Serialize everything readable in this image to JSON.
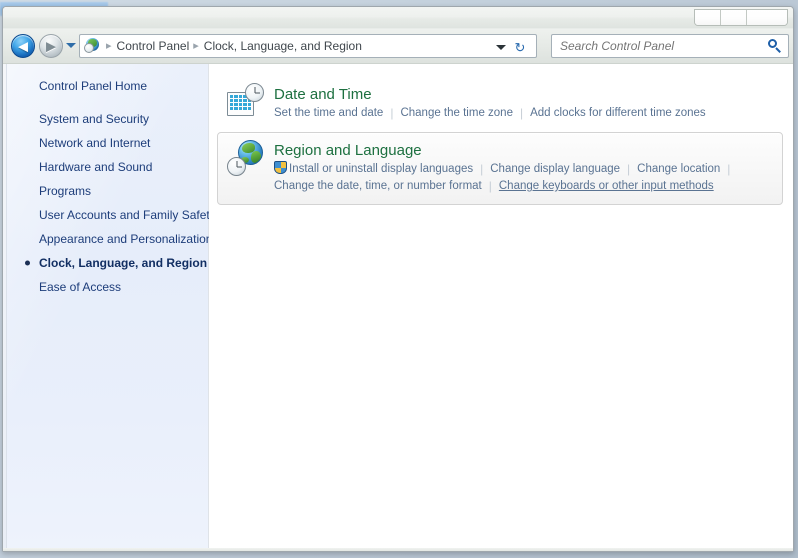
{
  "window": {
    "title": "",
    "buttons": [
      {
        "name": "minimize",
        "label": ""
      },
      {
        "name": "maximize",
        "label": ""
      },
      {
        "name": "close",
        "label": ""
      }
    ]
  },
  "toolbar": {
    "back_label": "◀",
    "forward_label": "▶",
    "recent_pages_label": "",
    "refresh_label": "↻",
    "breadcrumb_icon": "control-panel-globe-icon",
    "breadcrumbs": [
      "Control Panel",
      "Clock, Language, and Region"
    ],
    "separator": "▸"
  },
  "search": {
    "placeholder": "Search Control Panel",
    "value": "",
    "icon": "search-icon"
  },
  "sidebar": {
    "home": {
      "label": "Control Panel Home"
    },
    "items": [
      {
        "label": "System and Security",
        "selected": false
      },
      {
        "label": "Network and Internet",
        "selected": false
      },
      {
        "label": "Hardware and Sound",
        "selected": false
      },
      {
        "label": "Programs",
        "selected": false
      },
      {
        "label": "User Accounts and Family Safety",
        "selected": false
      },
      {
        "label": "Appearance and Personalization",
        "selected": false
      },
      {
        "label": "Clock, Language, and Region",
        "selected": true
      },
      {
        "label": "Ease of Access",
        "selected": false
      }
    ]
  },
  "main": {
    "categories": [
      {
        "id": "date-and-time",
        "icon": "calendar-clock-icon",
        "title": "Date and Time",
        "hover": false,
        "links": [
          {
            "label": "Set the time and date",
            "shield": false,
            "underlined": false
          },
          {
            "label": "Change the time zone",
            "shield": false,
            "underlined": false
          },
          {
            "label": "Add clocks for different time zones",
            "shield": false,
            "underlined": false
          }
        ],
        "row_break_after": -1
      },
      {
        "id": "region-and-language",
        "icon": "globe-clock-icon",
        "title": "Region and Language",
        "hover": true,
        "links": [
          {
            "label": "Install or uninstall display languages",
            "shield": true,
            "underlined": false
          },
          {
            "label": "Change display language",
            "shield": false,
            "underlined": false
          },
          {
            "label": "Change location",
            "shield": false,
            "underlined": false
          },
          {
            "label": "Change the date, time, or number format",
            "shield": false,
            "underlined": false
          },
          {
            "label": "Change keyboards or other input methods",
            "shield": false,
            "underlined": true
          }
        ],
        "row_break_after": 2
      }
    ]
  },
  "colors": {
    "category_title": "#1d7040",
    "link": "#5a7392",
    "sidebar_text": "#1d3d7a",
    "sidebar_bg": "#e8eefb",
    "accent_blue": "#1e5fa8",
    "breadcrumb_text": "#40474d"
  }
}
